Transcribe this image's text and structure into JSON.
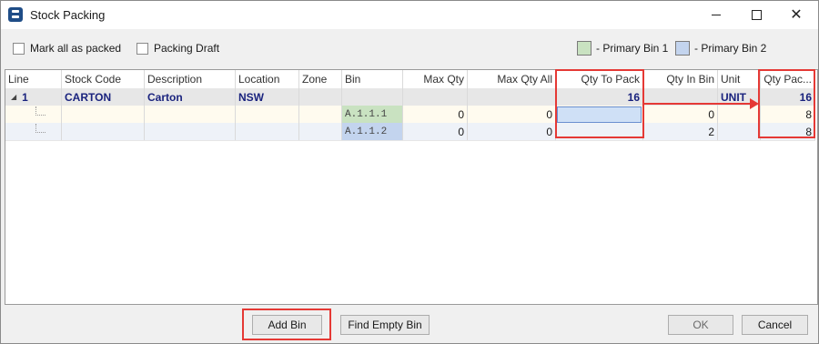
{
  "window": {
    "title": "Stock Packing"
  },
  "toolbar": {
    "mark_all_label": "Mark all as packed",
    "packing_draft_label": "Packing Draft",
    "legend": [
      {
        "label": "- Primary Bin 1",
        "color": "#c9e2c1"
      },
      {
        "label": "- Primary Bin 2",
        "color": "#c3d4ee"
      }
    ]
  },
  "grid": {
    "columns": [
      "Line",
      "Stock Code",
      "Description",
      "Location",
      "Zone",
      "Bin",
      "Max Qty",
      "Max Qty All",
      "Qty To Pack",
      "Qty In Bin",
      "Unit",
      "Qty Pac..."
    ],
    "parent": {
      "line": "1",
      "stock_code": "CARTON",
      "description": "Carton",
      "location": "NSW",
      "zone": "",
      "bin": "",
      "max_qty": "",
      "max_qty_all": "",
      "qty_to_pack": "16",
      "qty_in_bin": "",
      "unit": "UNIT",
      "qty_packed": "16"
    },
    "children": [
      {
        "bin": "A.1.1.1",
        "max_qty": "0",
        "max_qty_all": "0",
        "qty_to_pack": "",
        "qty_in_bin": "0",
        "qty_packed": "8"
      },
      {
        "bin": "A.1.1.2",
        "max_qty": "0",
        "max_qty_all": "0",
        "qty_to_pack": "",
        "qty_in_bin": "2",
        "qty_packed": "8"
      }
    ]
  },
  "buttons": {
    "add_bin_label": "Add Bin",
    "find_empty_bin_label": "Find Empty Bin",
    "ok_label": "OK",
    "cancel_label": "Cancel"
  },
  "colors": {
    "annotation": "#e53935",
    "bold_text": "#1a237e"
  },
  "icons": {
    "app": "app-icon",
    "minimize": "minimize-icon",
    "maximize": "maximize-icon",
    "close": "close-icon",
    "tree_toggle": "tree-collapse-icon",
    "arrow": "arrow-right-icon"
  }
}
